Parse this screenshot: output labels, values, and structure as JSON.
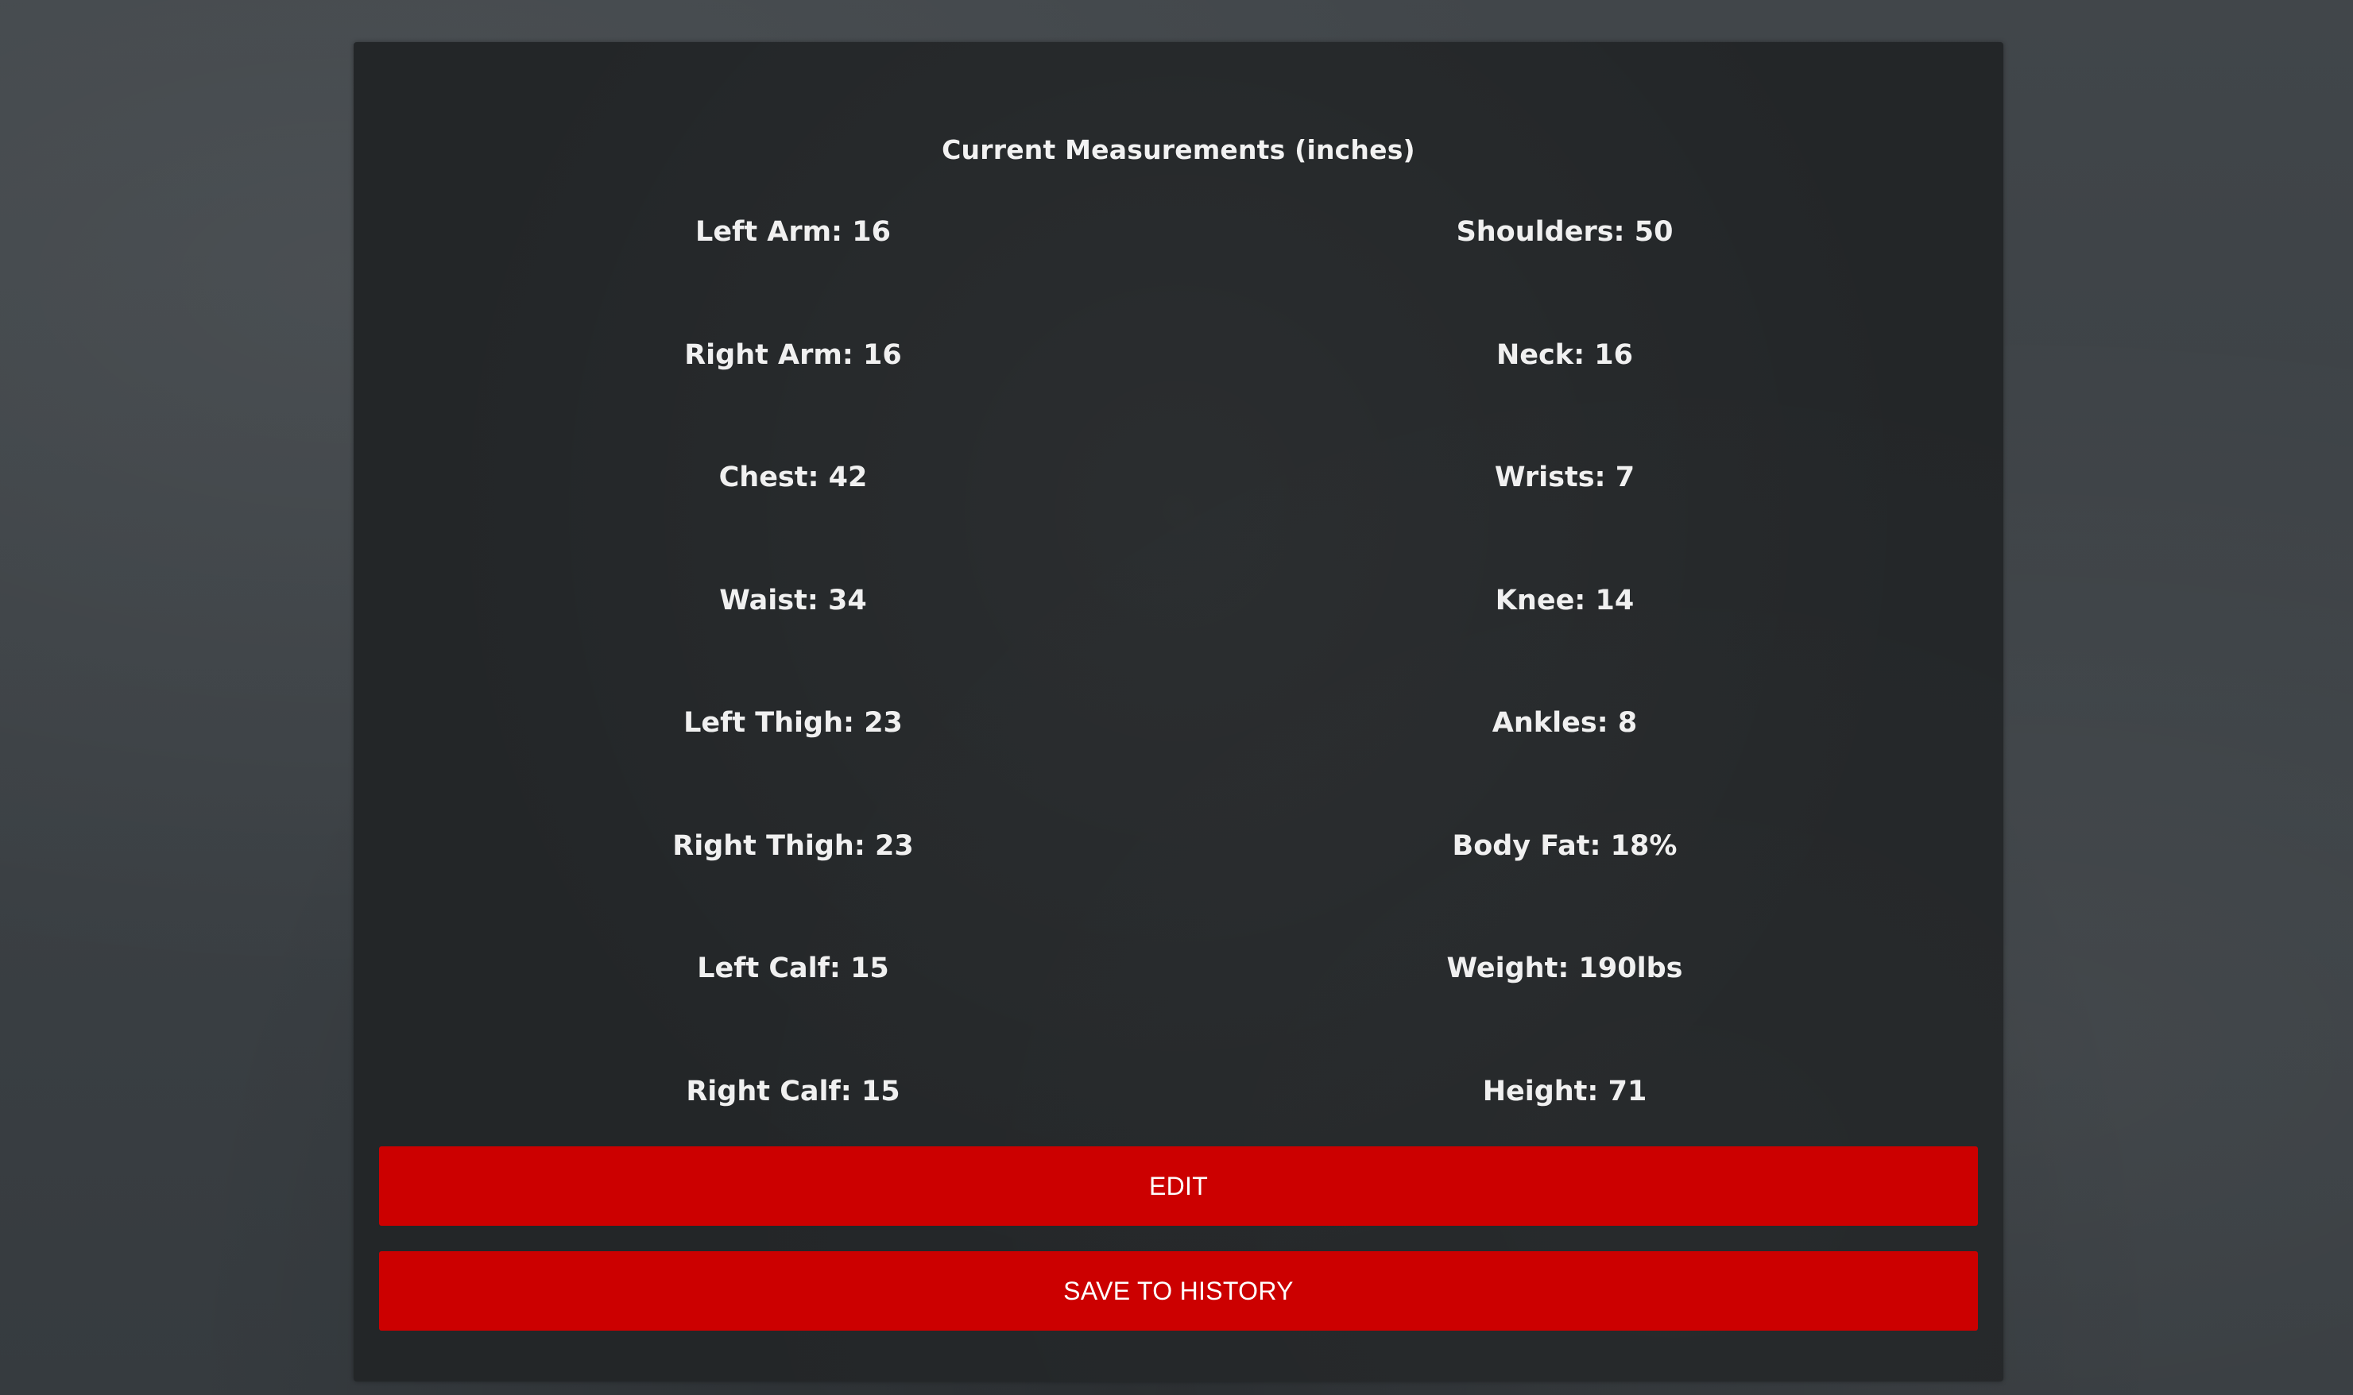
{
  "panel": {
    "title": "Current Measurements (inches)"
  },
  "measurements": {
    "left": [
      "Left Arm: 16",
      "Right Arm: 16",
      "Chest: 42",
      "Waist: 34",
      "Left Thigh: 23",
      "Right Thigh: 23",
      "Left Calf: 15",
      "Right Calf: 15"
    ],
    "right": [
      "Shoulders: 50",
      "Neck: 16",
      "Wrists: 7",
      "Knee: 14",
      "Ankles: 8",
      "Body Fat: 18%",
      "Weight: 190lbs",
      "Height: 71"
    ]
  },
  "actions": {
    "edit_label": "EDIT",
    "save_label": "SAVE TO HISTORY"
  },
  "colors": {
    "accent": "#cc0000",
    "panel": "#232628",
    "background": "#3d4246"
  }
}
